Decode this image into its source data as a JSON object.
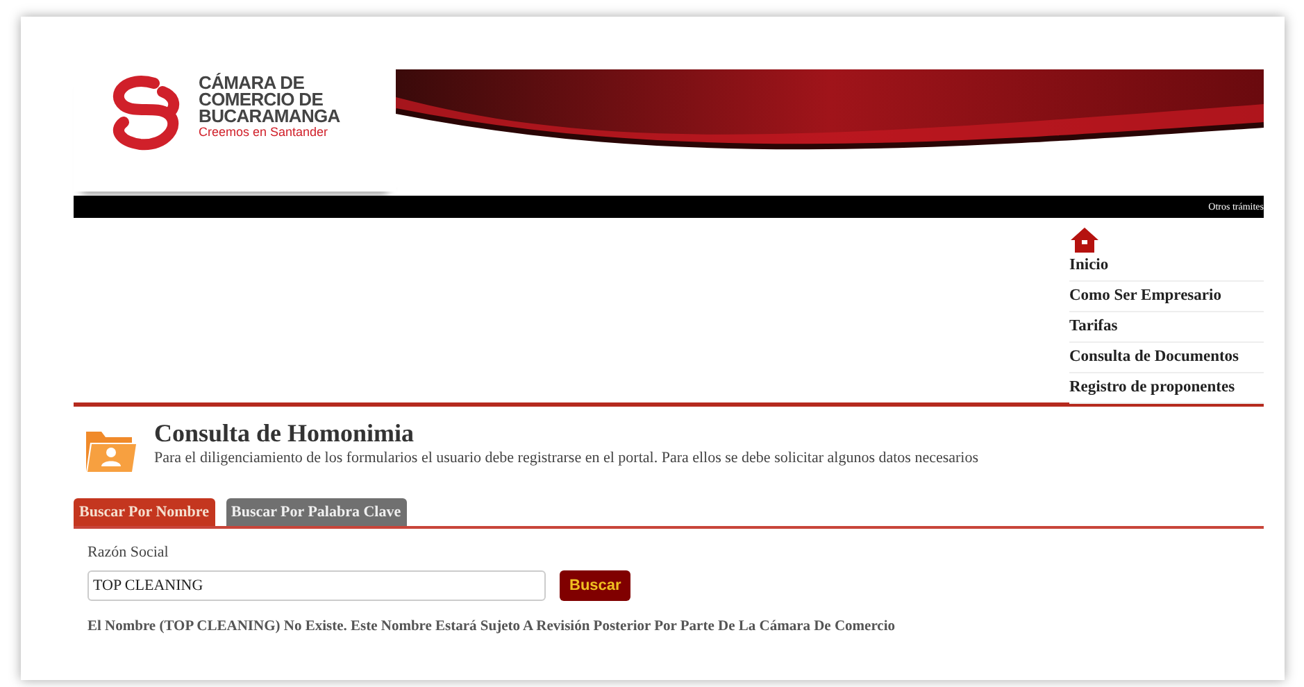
{
  "logo": {
    "lines": [
      "CÁMARA DE",
      "COMERCIO DE",
      "BUCARAMANGA"
    ],
    "tagline": "Creemos en Santander"
  },
  "top_bar": {
    "link": "Otros trámites"
  },
  "nav": {
    "items": [
      {
        "label": "Inicio",
        "kind": "home"
      },
      {
        "label": "Como Ser Empresario",
        "kind": "link"
      },
      {
        "label": "Tarifas",
        "kind": "link"
      },
      {
        "label": "Consulta de Documentos",
        "kind": "link"
      },
      {
        "label": "Registro de proponentes",
        "kind": "link"
      }
    ]
  },
  "section": {
    "title": "Consulta de Homonimia",
    "description": "Para el diligenciamiento de los formularios el usuario debe registrarse en el portal. Para ellos se debe solicitar algunos datos necesarios"
  },
  "tabs": [
    {
      "label": "Buscar Por Nombre",
      "selected": true
    },
    {
      "label": "Buscar Por Palabra Clave",
      "selected": false
    }
  ],
  "form": {
    "label": "Razón Social",
    "value": "TOP CLEANING",
    "button": "Buscar"
  },
  "result": "El Nombre (TOP CLEANING) No Existe. Este Nombre Estará Sujeto A Revisión Posterior Por Parte De La Cámara De Comercio"
}
